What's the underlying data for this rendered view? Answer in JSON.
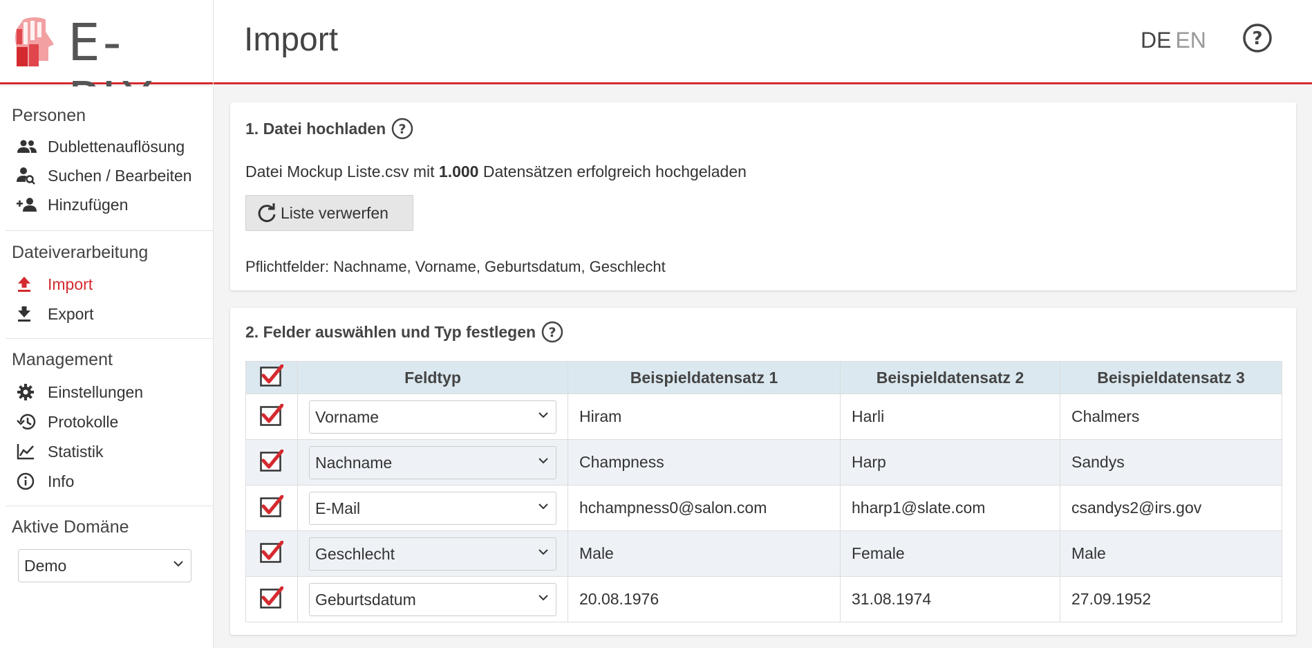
{
  "header": {
    "logo_text": "E-PIX",
    "page_title": "Import",
    "lang_de": "DE",
    "lang_en": "EN",
    "colors": {
      "accent": "#d42a2f",
      "logo_red": "#e0464b",
      "logo_pink": "#f2a0a2"
    }
  },
  "sidebar": {
    "sections": {
      "personen": {
        "title": "Personen",
        "items": [
          {
            "label": "Dublettenauflösung",
            "icon": "people-icon"
          },
          {
            "label": "Suchen / Bearbeiten",
            "icon": "person-search-icon"
          },
          {
            "label": "Hinzufügen",
            "icon": "person-add-icon"
          }
        ]
      },
      "dateiverarbeitung": {
        "title": "Dateiverarbeitung",
        "items": [
          {
            "label": "Import",
            "icon": "upload-icon",
            "active": true
          },
          {
            "label": "Export",
            "icon": "download-icon"
          }
        ]
      },
      "management": {
        "title": "Management",
        "items": [
          {
            "label": "Einstellungen",
            "icon": "gear-icon"
          },
          {
            "label": "Protokolle",
            "icon": "history-icon"
          },
          {
            "label": "Statistik",
            "icon": "chart-icon"
          },
          {
            "label": "Info",
            "icon": "info-icon"
          }
        ]
      },
      "domain": {
        "title": "Aktive Domäne",
        "selected": "Demo"
      }
    }
  },
  "upload": {
    "title": "1. Datei hochladen",
    "text_prefix": "Datei Mockup Liste.csv mit ",
    "count": "1.000",
    "text_suffix": " Datensätzen erfolgreich hochgeladen",
    "discard_label": "Liste verwerfen",
    "required": "Pflichtfelder: Nachname, Vorname, Geburtsdatum, Geschlecht"
  },
  "fields": {
    "title": "2. Felder auswählen und Typ festlegen",
    "headers": {
      "feldtyp": "Feldtyp",
      "b1": "Beispieldatensatz 1",
      "b2": "Beispieldatensatz 2",
      "b3": "Beispieldatensatz 3"
    },
    "rows": [
      {
        "type": "Vorname",
        "v1": "Hiram",
        "v2": "Harli",
        "v3": "Chalmers",
        "checked": true
      },
      {
        "type": "Nachname",
        "v1": "Champness",
        "v2": "Harp",
        "v3": "Sandys",
        "checked": true
      },
      {
        "type": "E-Mail",
        "v1": "hchampness0@salon.com",
        "v2": "hharp1@slate.com",
        "v3": "csandys2@irs.gov",
        "checked": true
      },
      {
        "type": "Geschlecht",
        "v1": "Male",
        "v2": "Female",
        "v3": "Male",
        "checked": true
      },
      {
        "type": "Geburtsdatum",
        "v1": "20.08.1976",
        "v2": "31.08.1974",
        "v3": "27.09.1952",
        "checked": true
      }
    ]
  }
}
